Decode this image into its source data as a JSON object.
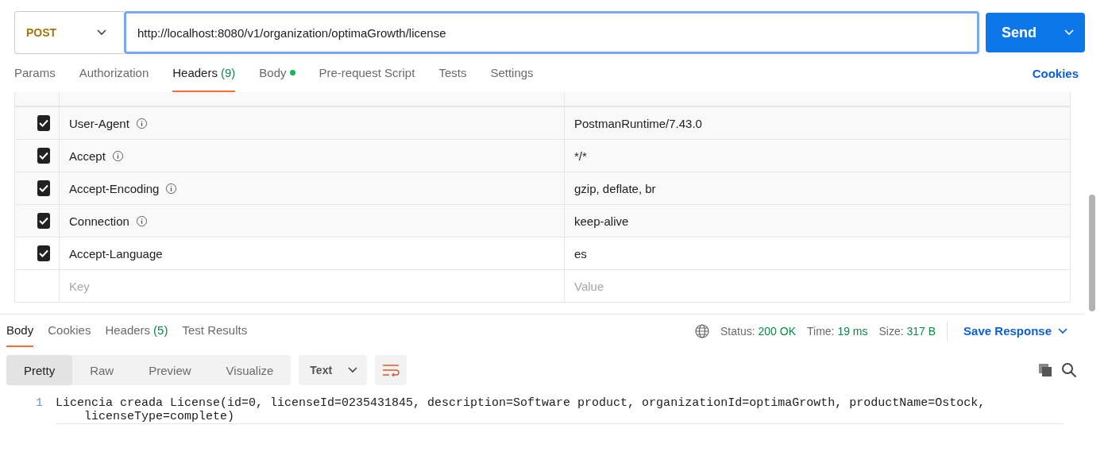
{
  "request": {
    "method": "POST",
    "url": "http://localhost:8080/v1/organization/optimaGrowth/license",
    "send": "Send"
  },
  "request_tabs": [
    {
      "label": "Params",
      "selected": false
    },
    {
      "label": "Authorization",
      "selected": false
    },
    {
      "label": "Headers",
      "count": "(9)",
      "selected": true
    },
    {
      "label": "Body",
      "dot": true,
      "selected": false
    },
    {
      "label": "Pre-request Script",
      "selected": false
    },
    {
      "label": "Tests",
      "selected": false
    },
    {
      "label": "Settings",
      "selected": false
    }
  ],
  "cookies_link": "Cookies",
  "headers": [
    {
      "key": "User-Agent",
      "info": true,
      "value": "PostmanRuntime/7.43.0",
      "checked": true
    },
    {
      "key": "Accept",
      "info": true,
      "value": "*/*",
      "checked": true
    },
    {
      "key": "Accept-Encoding",
      "info": true,
      "value": "gzip, deflate, br",
      "checked": true
    },
    {
      "key": "Connection",
      "info": true,
      "value": "keep-alive",
      "checked": true
    },
    {
      "key": "Accept-Language",
      "info": false,
      "value": "es",
      "checked": true
    }
  ],
  "new_header": {
    "key_placeholder": "Key",
    "value_placeholder": "Value"
  },
  "response_tabs": [
    {
      "label": "Body",
      "selected": true
    },
    {
      "label": "Cookies",
      "selected": false
    },
    {
      "label": "Headers",
      "count": "(5)",
      "selected": false
    },
    {
      "label": "Test Results",
      "selected": false
    }
  ],
  "status": [
    {
      "label": "Status:",
      "value": "200 OK"
    },
    {
      "label": "Time:",
      "value": "19 ms"
    },
    {
      "label": "Size:",
      "value": "317 B"
    }
  ],
  "save_response": "Save Response",
  "view_modes": [
    {
      "label": "Pretty",
      "selected": true
    },
    {
      "label": "Raw",
      "selected": false
    },
    {
      "label": "Preview",
      "selected": false
    },
    {
      "label": "Visualize",
      "selected": false
    }
  ],
  "format": "Text",
  "code_lines": [
    {
      "number": "1",
      "text": "Licencia creada License(id=0, licenseId=0235431845, description=Software product, organizationId=optimaGrowth, productName=Ostock,",
      "continuation": "licenseType=complete)"
    }
  ]
}
